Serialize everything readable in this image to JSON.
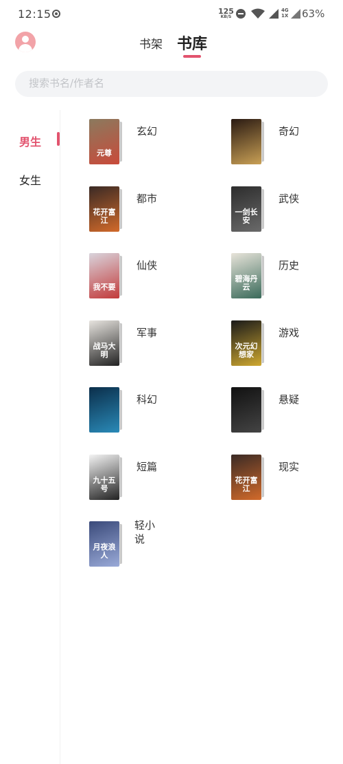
{
  "status_bar": {
    "time": "12:15",
    "net_speed_value": "125",
    "net_speed_unit": "KB/S",
    "network": "4G\n1X",
    "battery": "63%"
  },
  "header": {
    "tab_shelf": "书架",
    "tab_library": "书库",
    "active_tab": "书库",
    "accent_color": "#e2536e"
  },
  "search": {
    "placeholder": "搜索书名/作者名"
  },
  "sidebar": {
    "items": [
      {
        "label": "男生",
        "active": true
      },
      {
        "label": "女生",
        "active": false
      }
    ]
  },
  "categories": [
    {
      "label": "玄幻",
      "cover_text": "元尊",
      "cover_colors": [
        "#8b7a5e",
        "#c94a3a"
      ]
    },
    {
      "label": "奇幻",
      "cover_text": "",
      "cover_colors": [
        "#2a1a12",
        "#c9a055"
      ]
    },
    {
      "label": "都市",
      "cover_text": "花开富江",
      "cover_colors": [
        "#3a2a25",
        "#d26a2a"
      ]
    },
    {
      "label": "武侠",
      "cover_text": "一剑长安",
      "cover_colors": [
        "#2d2d2d",
        "#6a6a6a"
      ]
    },
    {
      "label": "仙侠",
      "cover_text": "我不要",
      "cover_colors": [
        "#d9d4dc",
        "#c23a3a"
      ]
    },
    {
      "label": "历史",
      "cover_text": "碧海丹云",
      "cover_colors": [
        "#e8e4da",
        "#3a6a5a"
      ]
    },
    {
      "label": "军事",
      "cover_text": "战马大明",
      "cover_colors": [
        "#e7e4df",
        "#222222"
      ]
    },
    {
      "label": "游戏",
      "cover_text": "次元幻想家",
      "cover_colors": [
        "#1a1a1a",
        "#cfa830"
      ]
    },
    {
      "label": "科幻",
      "cover_text": "",
      "cover_colors": [
        "#0b2e4a",
        "#2a8ab8"
      ]
    },
    {
      "label": "悬疑",
      "cover_text": "",
      "cover_colors": [
        "#111111",
        "#444444"
      ]
    },
    {
      "label": "短篇",
      "cover_text": "九十五号",
      "cover_colors": [
        "#f4f4f4",
        "#222222"
      ]
    },
    {
      "label": "现实",
      "cover_text": "花开富江",
      "cover_colors": [
        "#3a2a25",
        "#d26a2a"
      ]
    },
    {
      "label": "轻小说",
      "cover_text": "月夜浪人",
      "cover_colors": [
        "#3a4a7a",
        "#9aaad8"
      ]
    }
  ]
}
